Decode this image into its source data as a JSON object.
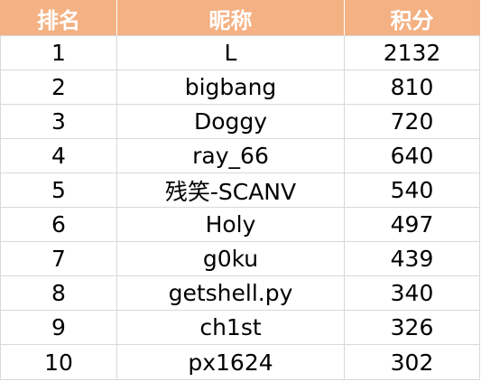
{
  "table": {
    "headers": {
      "rank": "排名",
      "name": "昵称",
      "score": "积分"
    },
    "rows": [
      {
        "rank": "1",
        "name": "L",
        "score": "2132"
      },
      {
        "rank": "2",
        "name": "bigbang",
        "score": "810"
      },
      {
        "rank": "3",
        "name": "Doggy",
        "score": "720"
      },
      {
        "rank": "4",
        "name": "ray_66",
        "score": "640"
      },
      {
        "rank": "5",
        "name": "残笑-SCANV",
        "score": "540"
      },
      {
        "rank": "6",
        "name": "Holy",
        "score": "497"
      },
      {
        "rank": "7",
        "name": "g0ku",
        "score": "439"
      },
      {
        "rank": "8",
        "name": "getshell.py",
        "score": "340"
      },
      {
        "rank": "9",
        "name": "ch1st",
        "score": "326"
      },
      {
        "rank": "10",
        "name": "px1624",
        "score": "302"
      }
    ]
  },
  "colors": {
    "header_background": "#f4b183",
    "header_text": "#ffffff",
    "grid_line": "#d9d9d9",
    "cell_text": "#000000"
  }
}
